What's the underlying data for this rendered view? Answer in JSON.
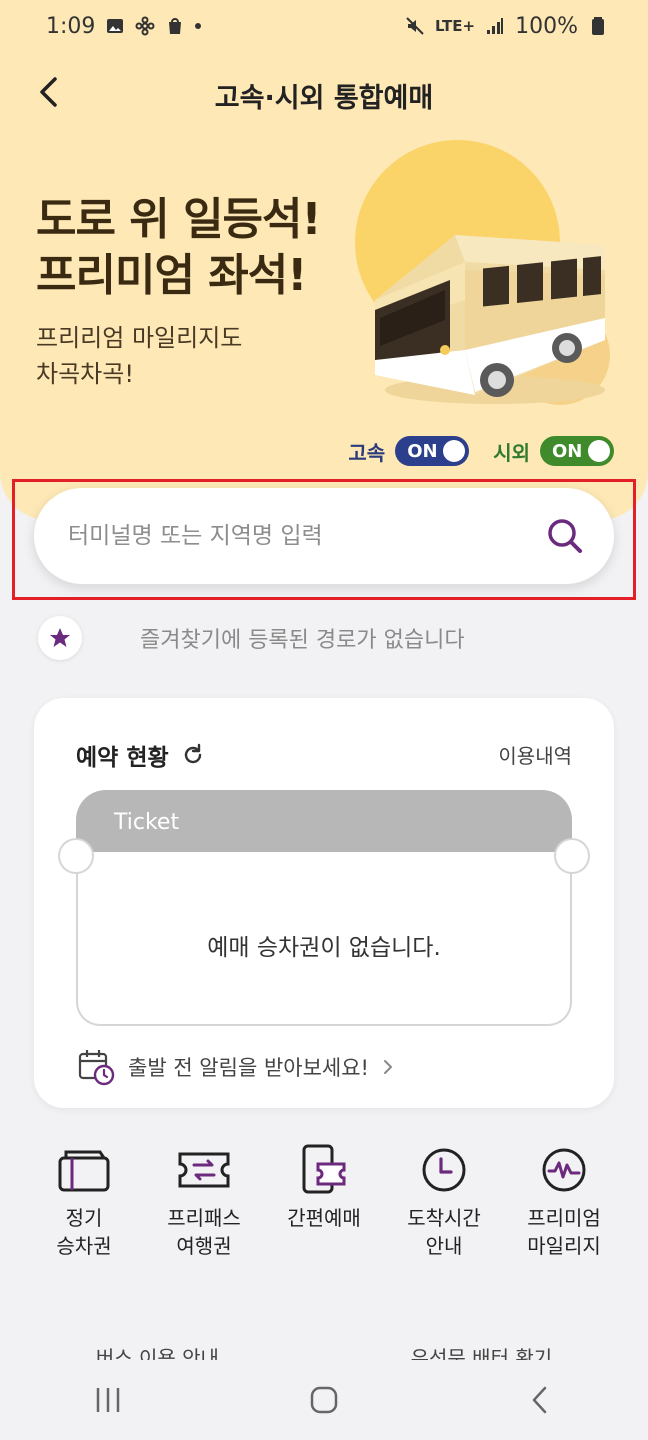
{
  "status_bar": {
    "time": "1:09",
    "network": "LTE+",
    "battery": "100%"
  },
  "header": {
    "title": "고속·시외 통합예매"
  },
  "banner": {
    "headline_line1": "도로 위 일등석!",
    "headline_line2": "프리미엄 좌석!",
    "subline_line1": "프리리엄 마일리지도",
    "subline_line2": "차곡차곡!"
  },
  "toggles": {
    "express_label": "고속",
    "express_state": "ON",
    "intercity_label": "시외",
    "intercity_state": "ON"
  },
  "search": {
    "placeholder": "터미널명 또는 지역명 입력"
  },
  "favorites": {
    "empty_text": "즐겨찾기에 등록된 경로가 없습니다"
  },
  "reservation": {
    "title": "예약 현황",
    "history_link": "이용내역",
    "ticket_label": "Ticket",
    "empty_text": "예매 승차권이 없습니다.",
    "alarm_text": "출발 전 알림을 받아보세요!"
  },
  "shortcuts": [
    {
      "line1": "정기",
      "line2": "승차권",
      "icon": "ticket-card-icon"
    },
    {
      "line1": "프리패스",
      "line2": "여행권",
      "icon": "freepass-icon"
    },
    {
      "line1": "간편예매",
      "line2": "",
      "icon": "phone-ticket-icon"
    },
    {
      "line1": "도착시간",
      "line2": "안내",
      "icon": "clock-icon"
    },
    {
      "line1": "프리미엄",
      "line2": "마일리지",
      "icon": "mileage-icon"
    }
  ],
  "bottom_links": {
    "left": "버스 이용 안내",
    "right": "우선문 배터 확기"
  },
  "colors": {
    "hero_bg": "#fde8b6",
    "accent_purple": "#6b2a7e",
    "express_toggle": "#2c3f8c",
    "intercity_toggle": "#3f8a2a",
    "highlight_red": "#e32027"
  }
}
